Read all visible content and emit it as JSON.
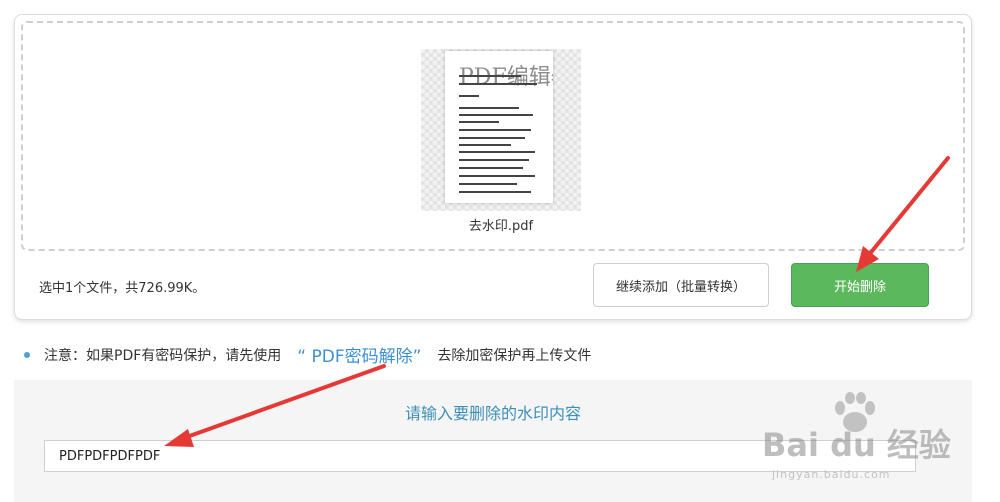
{
  "upload": {
    "file_name": "去水印.pdf",
    "thumbnail_watermark": "PDF编辑器",
    "summary": "选中1个文件，共726.99K。",
    "add_button": "继续添加（批量转换）",
    "start_button": "开始删除"
  },
  "notice": {
    "prefix": "注意：如果PDF有密码保护，请先使用",
    "link": "“ PDF密码解除”",
    "suffix": "去除加密保护再上传文件"
  },
  "watermark_panel": {
    "title": "请输入要删除的水印内容",
    "input_value": "PDFPDFPDFPDF"
  },
  "overlay": {
    "brand": "Bai du 经验",
    "url": "jingyan.baidu.com"
  },
  "colors": {
    "start_button": "#5cb85c",
    "link": "#3d8fd1",
    "arrow": "#e53935"
  }
}
